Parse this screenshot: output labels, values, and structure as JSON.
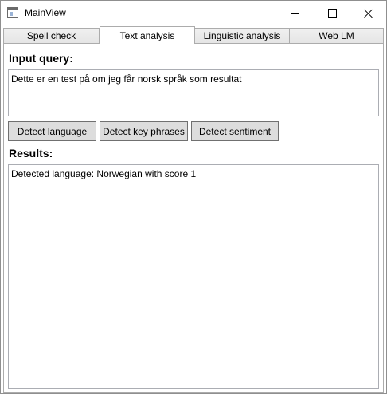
{
  "window": {
    "title": "MainView",
    "icon": "app-window-icon",
    "controls": [
      "minimize-icon",
      "maximize-icon",
      "close-icon"
    ]
  },
  "tabs": [
    {
      "label": "Spell check",
      "active": false
    },
    {
      "label": "Text analysis",
      "active": true
    },
    {
      "label": "Linguistic analysis",
      "active": false
    },
    {
      "label": "Web LM",
      "active": false
    }
  ],
  "main": {
    "input_label": "Input query:",
    "input_value": "Dette er en test på om jeg får norsk språk som resultat",
    "buttons": {
      "detect_language": "Detect language",
      "detect_key_phrases": "Detect key phrases",
      "detect_sentiment": "Detect sentiment"
    },
    "results_label": "Results:",
    "results_value": "Detected language: Norwegian with score 1"
  }
}
